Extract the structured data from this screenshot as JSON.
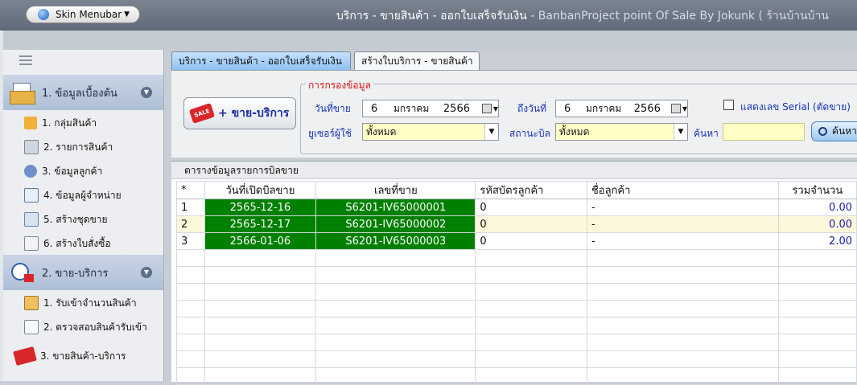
{
  "app": {
    "skin_menu_label": "Skin Menubar",
    "title_main": "บริการ - ขายสินค้า - ออกใบเสร็จรับเงิน",
    "title_sub": " - BanbanProject point Of Sale By Jokunk  ( ร้านบ้านบ้าน"
  },
  "sidebar": {
    "groups": [
      {
        "label": "1. ข้อมูลเบื้องต้น",
        "items": [
          "1. กลุ่มสินค้า",
          "2. รายการสินค้า",
          "3. ข้อมูลลูกค้า",
          "4. ข้อมูลผู้จำหน่าย",
          "5. สร้างชุดขาย",
          "6. สร้างใบสั่งซื้อ"
        ]
      },
      {
        "label": "2. ขาย-บริการ",
        "items": [
          "1. รับเข้าจำนวนสินค้า",
          "2. ตรวจสอบสินค้ารับเข้า",
          "3. ขายสินค้า-บริการ"
        ]
      }
    ]
  },
  "tabs": [
    "บริการ - ขายสินค้า - ออกใบเสร็จรับเงิน",
    "สร้างใบบริการ - ขายสินค้า"
  ],
  "filter": {
    "sale_button_label": "+ ขาย-บริการ",
    "sale_tag": "SALE",
    "legend": "การกรองข้อมูล",
    "date_from_label": "วันที่ขาย",
    "date_from": {
      "day": "6",
      "month": "มกราคม",
      "year": "2566"
    },
    "date_to_label": "ถึงวันที่",
    "date_to": {
      "day": "6",
      "month": "มกราคม",
      "year": "2566"
    },
    "user_label": "ยูเซอร์ผู้ใช้",
    "user_value": "ทั้งหมด",
    "status_label": "สถานะบิล",
    "status_value": "ทั้งหมด",
    "serial_label": "แสดงเลข Serial (ตัดขาย)",
    "search_label": "ค้นหา",
    "search_value": "",
    "search_button": "ค้นหา"
  },
  "grid": {
    "caption": "ตารางข้อมูลรายการบิลขาย",
    "columns": [
      "*",
      "วันที่เปิดบิลขาย",
      "เลขที่ขาย",
      "รหัสบัตรลูกค้า",
      "ชื่อลูกค้า",
      "รวมจำนวน"
    ],
    "rows": [
      {
        "no": "1",
        "date": "2565-12-16",
        "invoice": "S6201-IV65000001",
        "card": "0",
        "customer": "-",
        "total": "0.00"
      },
      {
        "no": "2",
        "date": "2565-12-17",
        "invoice": "S6201-IV65000002",
        "card": "0",
        "customer": "-",
        "total": "0.00"
      },
      {
        "no": "3",
        "date": "2566-01-06",
        "invoice": "S6201-IV65000003",
        "card": "0",
        "customer": "-",
        "total": "2.00"
      }
    ]
  },
  "colors": {
    "accent_blue": "#1933b5",
    "row_green": "#008000",
    "legend_red": "#d21414"
  }
}
